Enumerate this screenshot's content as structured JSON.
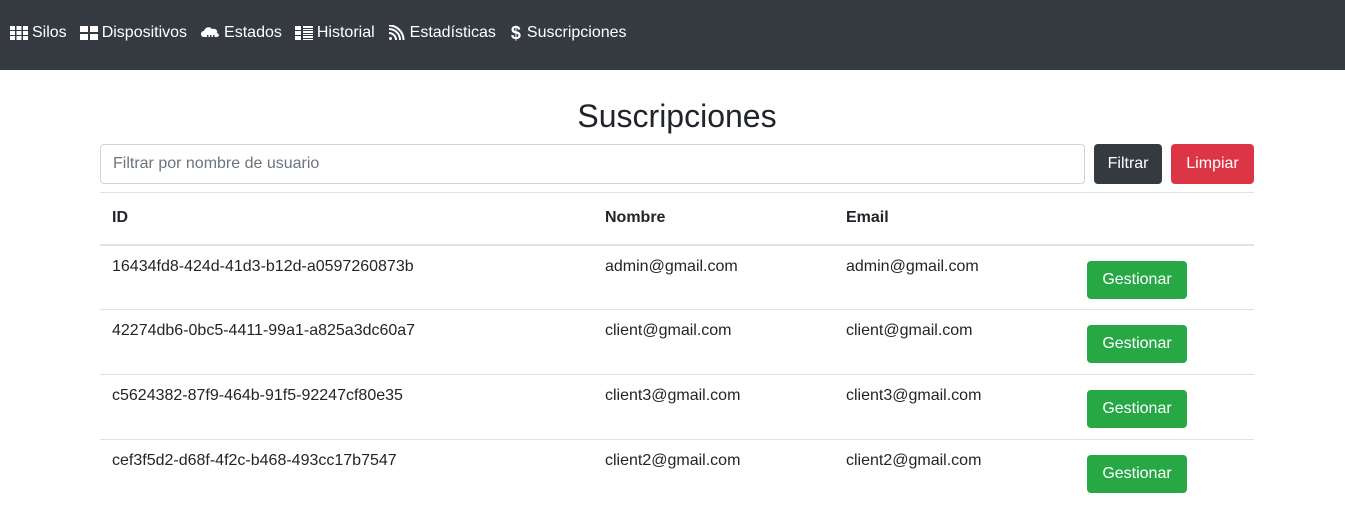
{
  "nav": {
    "items": [
      {
        "label": "Silos",
        "icon": "grid-icon"
      },
      {
        "label": "Dispositivos",
        "icon": "blocks-icon"
      },
      {
        "label": "Estados",
        "icon": "cloud-icon"
      },
      {
        "label": "Historial",
        "icon": "list-icon"
      },
      {
        "label": "Estadísticas",
        "icon": "rss-icon"
      },
      {
        "label": "Suscripciones",
        "icon": "dollar-icon"
      }
    ]
  },
  "page": {
    "title": "Suscripciones"
  },
  "filter": {
    "placeholder": "Filtrar por nombre de usuario",
    "value": "",
    "filter_label": "Filtrar",
    "clear_label": "Limpiar"
  },
  "table": {
    "headers": [
      "ID",
      "Nombre",
      "Email",
      ""
    ],
    "rows": [
      {
        "id": "16434fd8-424d-41d3-b12d-a0597260873b",
        "nombre": "admin@gmail.com",
        "email": "admin@gmail.com",
        "action": "Gestionar"
      },
      {
        "id": "42274db6-0bc5-4411-99a1-a825a3dc60a7",
        "nombre": "client@gmail.com",
        "email": "client@gmail.com",
        "action": "Gestionar"
      },
      {
        "id": "c5624382-87f9-464b-91f5-92247cf80e35",
        "nombre": "client3@gmail.com",
        "email": "client3@gmail.com",
        "action": "Gestionar"
      },
      {
        "id": "cef3f5d2-d68f-4f2c-b468-493cc17b7547",
        "nombre": "client2@gmail.com",
        "email": "client2@gmail.com",
        "action": "Gestionar"
      }
    ]
  },
  "colors": {
    "navbar": "#343a40",
    "dark": "#343a40",
    "danger": "#dc3545",
    "success": "#28a745"
  }
}
